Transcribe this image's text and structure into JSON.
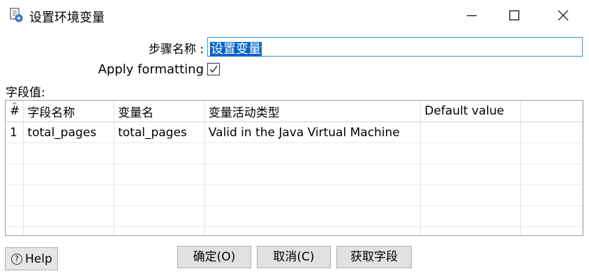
{
  "window": {
    "title": "设置环境变量",
    "icon": "kettle-step-icon"
  },
  "form": {
    "step_name_label": "步骤名称 :",
    "step_name_value": "设置变量",
    "apply_formatting_label": "Apply formatting",
    "apply_formatting_checked": true,
    "fields_label": "字段值:"
  },
  "table": {
    "headers": [
      "#",
      "字段名称",
      "变量名",
      "变量活动类型",
      "Default value"
    ],
    "rows": [
      [
        "1",
        "total_pages",
        "total_pages",
        "Valid in the Java Virtual Machine",
        ""
      ]
    ]
  },
  "buttons": {
    "help": "Help",
    "ok": "确定(O)",
    "cancel": "取消(C)",
    "get_fields": "获取字段"
  }
}
